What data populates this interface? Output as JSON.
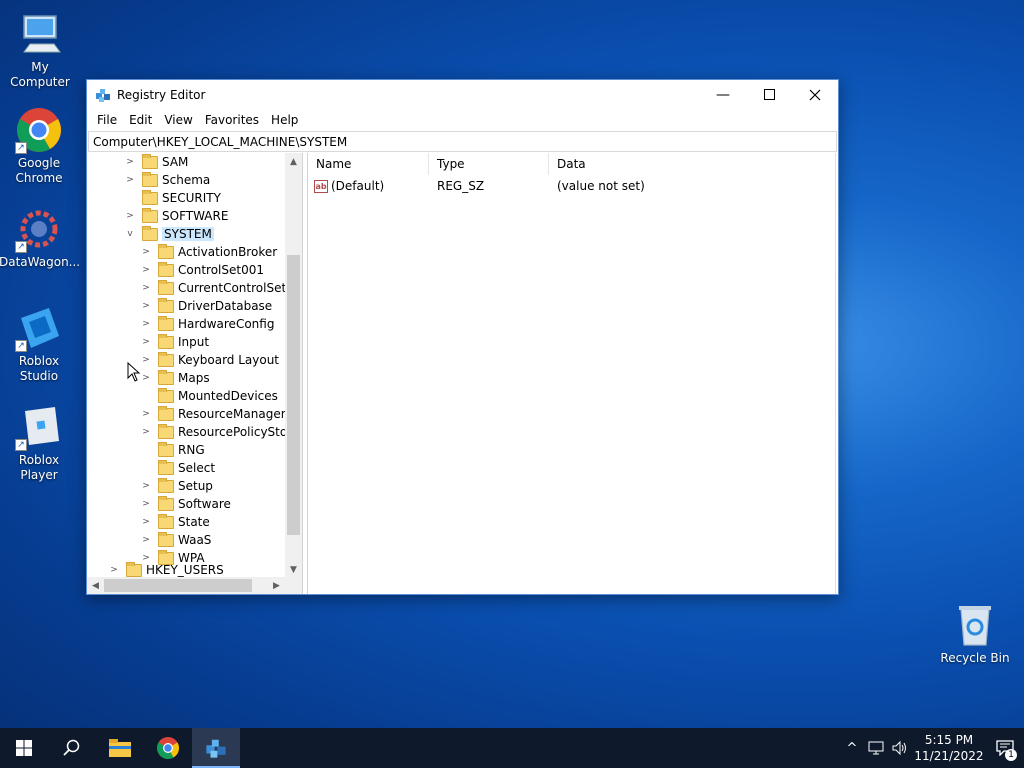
{
  "desktop": {
    "icons": [
      {
        "label": "My Computer",
        "icon": "computer-icon"
      },
      {
        "label": "Google Chrome",
        "icon": "chrome-icon"
      },
      {
        "label": "DataWagon...",
        "icon": "datawagon-icon"
      },
      {
        "label": "Roblox Studio",
        "icon": "roblox-studio-icon"
      },
      {
        "label": "Roblox Player",
        "icon": "roblox-player-icon"
      },
      {
        "label": "Recycle Bin",
        "icon": "recycle-bin-icon"
      }
    ]
  },
  "window": {
    "title": "Registry Editor",
    "menu": [
      "File",
      "Edit",
      "View",
      "Favorites",
      "Help"
    ],
    "address": "Computer\\HKEY_LOCAL_MACHINE\\SYSTEM",
    "tree": {
      "top_items": [
        "SAM",
        "Schema",
        "SECURITY",
        "SOFTWARE"
      ],
      "selected": "SYSTEM",
      "children": [
        "ActivationBroker",
        "ControlSet001",
        "CurrentControlSet",
        "DriverDatabase",
        "HardwareConfig",
        "Input",
        "Keyboard Layout",
        "Maps",
        "MountedDevices",
        "ResourceManager",
        "ResourcePolicyStore",
        "RNG",
        "Select",
        "Setup",
        "Software",
        "State",
        "WaaS",
        "WPA"
      ],
      "next_root": "HKEY_USERS"
    },
    "list": {
      "columns": [
        "Name",
        "Type",
        "Data"
      ],
      "rows": [
        {
          "name": "(Default)",
          "type": "REG_SZ",
          "data": "(value not set)"
        }
      ]
    }
  },
  "taskbar": {
    "time": "5:15 PM",
    "date": "11/21/2022",
    "notification_count": "1"
  },
  "colors": {
    "taskbar_bg": "#0e1a2b",
    "selection": "#cce8ff",
    "folder": "#f8d775"
  }
}
